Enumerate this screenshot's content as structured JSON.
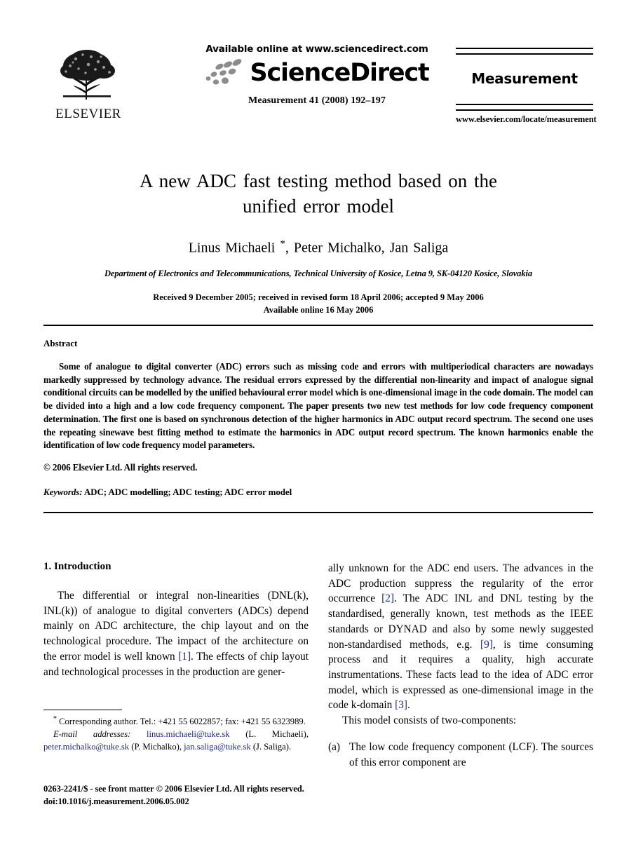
{
  "masthead": {
    "publisher": "ELSEVIER",
    "available_online": "Available online at www.sciencedirect.com",
    "sciencedirect_wordmark": "ScienceDirect",
    "citation": "Measurement 41 (2008) 192–197",
    "journal_name": "Measurement",
    "journal_url": "www.elsevier.com/locate/measurement"
  },
  "title_block": {
    "title_line1": "A new ADC fast testing method based on the",
    "title_line2": "unified error model",
    "authors_pre": "Linus Michaeli ",
    "authors_star": "*",
    "authors_post": ", Peter Michalko, Jan Saliga",
    "affiliation": "Department of Electronics and Telecommunications, Technical University of Kosice, Letna 9, SK-04120 Kosice, Slovakia",
    "received_line": "Received 9 December 2005; received in revised form 18 April 2006; accepted 9 May 2006",
    "available_line": "Available online 16 May 2006"
  },
  "abstract": {
    "heading": "Abstract",
    "body": "Some of analogue to digital converter (ADC) errors such as missing code and errors with multiperiodical characters are nowadays markedly suppressed by technology advance. The residual errors expressed by the differential non-linearity and impact of analogue signal conditional circuits can be modelled by the unified behavioural error model which is one-dimensional image in the code domain. The model can be divided into a high and a low code frequency component. The paper presents two new test methods for low code frequency component determination. The first one is based on synchronous detection of the higher harmonics in ADC output record spectrum. The second one uses the repeating sinewave best fitting method to estimate the harmonics in ADC output record spectrum. The known harmonics enable the identification of low code frequency model parameters.",
    "copyright": "© 2006 Elsevier Ltd. All rights reserved.",
    "keywords_label": "Keywords:",
    "keywords_value": "ADC; ADC modelling; ADC testing; ADC error model"
  },
  "sections": {
    "intro_heading": "1. Introduction",
    "intro_p1_a": "The differential or integral non-linearities (DNL(k), INL(k)) of analogue to digital converters (ADCs) depend mainly on ADC architecture, the chip layout and on the technological procedure. The impact of the architecture on the error model is well known ",
    "intro_ref1": "[1]",
    "intro_p1_b": ". The effects of chip layout and technological processes in the production are gener-",
    "intro_p1_cont_a": "ally unknown for the ADC end users. The advances in the ADC production suppress the regularity of the error occurrence ",
    "intro_ref2": "[2]",
    "intro_p1_cont_b": ". The ADC INL and DNL testing by the standardised, generally known, test methods as the IEEE standards or DYNAD and also by some newly suggested non-standardised methods, e.g. ",
    "intro_ref9": "[9]",
    "intro_p1_cont_c": ", is time consuming process and it requires a quality, high accurate instrumentations. These facts lead to the idea of ADC error model, which is expressed as one-dimensional image in the code k-domain ",
    "intro_ref3": "[3]",
    "intro_p1_cont_d": ".",
    "intro_p2": "This model consists of two-components:",
    "list_a_marker": "(a)",
    "list_a_text": "The low code frequency component (LCF). The sources of this error component are"
  },
  "footnote": {
    "star": "*",
    "corresponding": " Corresponding author. Tel.: +421 55 6022857; fax: +421 55 6323989.",
    "email_label": "E-mail addresses:",
    "email1": "linus.michaeli@tuke.sk",
    "email1_owner": " (L. Michaeli), ",
    "email2": "peter.michalko@tuke.sk",
    "email2_owner": " (P. Michalko), ",
    "email3": "jan.saliga@tuke.sk",
    "email3_owner": " (J. Saliga)."
  },
  "colophon": {
    "line1": "0263-2241/$ - see front matter © 2006 Elsevier Ltd. All rights reserved.",
    "line2": "doi:10.1016/j.measurement.2006.05.002"
  },
  "colors": {
    "link": "#1b2a8a",
    "text": "#000000",
    "background": "#ffffff"
  }
}
